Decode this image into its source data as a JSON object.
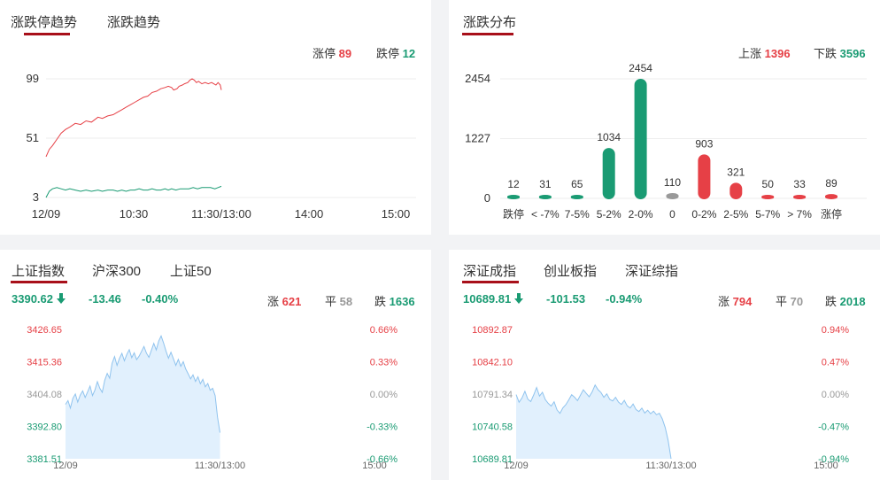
{
  "panel_limit": {
    "tabs": [
      "涨跌停趋势",
      "涨跌趋势"
    ],
    "stats": {
      "up_label": "涨停",
      "up_value": "89",
      "down_label": "跌停",
      "down_value": "12"
    }
  },
  "panel_dist": {
    "tabs": [
      "涨跌分布"
    ],
    "stats": {
      "up_label": "上涨",
      "up_value": "1396",
      "down_label": "下跌",
      "down_value": "3596"
    }
  },
  "panel_sh": {
    "tabs": [
      "上证指数",
      "沪深300",
      "上证50"
    ],
    "price": "3390.62",
    "change": "-13.46",
    "pct": "-0.40%",
    "stats": {
      "up_label": "涨",
      "up_value": "621",
      "flat_label": "平",
      "flat_value": "58",
      "down_label": "跌",
      "down_value": "1636"
    }
  },
  "panel_sz": {
    "tabs": [
      "深证成指",
      "创业板指",
      "深证综指"
    ],
    "price": "10689.81",
    "change": "-101.53",
    "pct": "-0.94%",
    "stats": {
      "up_label": "涨",
      "up_value": "794",
      "flat_label": "平",
      "flat_value": "70",
      "down_label": "跌",
      "down_value": "2018"
    }
  },
  "colors": {
    "red": "#e64046",
    "green": "#1a9b73",
    "gray": "#999999",
    "accent": "#a8101a",
    "area": "#e1f0fd",
    "area_line": "#8fc3ee"
  },
  "chart_data": [
    {
      "type": "line",
      "x_ticks": [
        "12/09",
        "10:30",
        "11:30/13:00",
        "14:00",
        "15:00"
      ],
      "y_ticks": [
        "99",
        "51",
        "3"
      ],
      "ylim": [
        3,
        99
      ],
      "series": [
        {
          "color": "red",
          "points": [
            [
              0,
              36
            ],
            [
              3,
              42
            ],
            [
              6,
              45
            ],
            [
              10,
              50
            ],
            [
              14,
              55
            ],
            [
              18,
              58
            ],
            [
              22,
              60
            ],
            [
              27,
              63
            ],
            [
              32,
              62
            ],
            [
              37,
              65
            ],
            [
              42,
              64
            ],
            [
              48,
              68
            ],
            [
              52,
              67
            ],
            [
              57,
              69
            ],
            [
              62,
              70
            ],
            [
              66,
              72
            ],
            [
              70,
              74
            ],
            [
              74,
              76
            ],
            [
              78,
              78
            ],
            [
              82,
              80
            ],
            [
              86,
              82
            ],
            [
              90,
              84
            ],
            [
              94,
              85
            ],
            [
              98,
              88
            ],
            [
              102,
              89
            ],
            [
              106,
              91
            ],
            [
              110,
              92
            ],
            [
              113,
              93
            ],
            [
              116,
              92
            ],
            [
              118,
              90
            ],
            [
              121,
              91
            ],
            [
              123,
              93
            ],
            [
              126,
              94
            ],
            [
              128,
              95
            ],
            [
              131,
              96
            ],
            [
              133,
              98
            ],
            [
              135,
              99
            ],
            [
              137,
              98
            ],
            [
              139,
              96
            ],
            [
              141,
              97
            ],
            [
              144,
              95
            ],
            [
              147,
              96
            ],
            [
              150,
              95
            ],
            [
              153,
              96
            ],
            [
              155,
              95
            ],
            [
              157,
              94
            ],
            [
              159,
              96
            ],
            [
              161,
              94
            ],
            [
              162,
              90
            ]
          ]
        },
        {
          "color": "green",
          "points": [
            [
              0,
              3
            ],
            [
              3,
              8
            ],
            [
              6,
              10
            ],
            [
              10,
              11
            ],
            [
              14,
              10
            ],
            [
              18,
              9
            ],
            [
              22,
              10
            ],
            [
              27,
              9
            ],
            [
              32,
              8
            ],
            [
              37,
              9
            ],
            [
              42,
              8
            ],
            [
              48,
              9
            ],
            [
              52,
              8
            ],
            [
              57,
              9
            ],
            [
              62,
              9
            ],
            [
              66,
              8
            ],
            [
              70,
              9
            ],
            [
              74,
              8
            ],
            [
              78,
              9
            ],
            [
              82,
              9
            ],
            [
              86,
              10
            ],
            [
              90,
              9
            ],
            [
              94,
              9
            ],
            [
              98,
              10
            ],
            [
              102,
              9
            ],
            [
              106,
              9
            ],
            [
              110,
              10
            ],
            [
              113,
              9
            ],
            [
              116,
              10
            ],
            [
              120,
              9
            ],
            [
              124,
              10
            ],
            [
              128,
              10
            ],
            [
              132,
              10
            ],
            [
              136,
              11
            ],
            [
              140,
              10
            ],
            [
              144,
              11
            ],
            [
              148,
              11
            ],
            [
              152,
              11
            ],
            [
              156,
              10
            ],
            [
              159,
              11
            ],
            [
              162,
              12
            ]
          ]
        }
      ]
    },
    {
      "type": "bar",
      "categories": [
        "跌停",
        "< -7%",
        "7-5%",
        "5-2%",
        "2-0%",
        "0",
        "0-2%",
        "2-5%",
        "5-7%",
        "> 7%",
        "涨停"
      ],
      "values": [
        12,
        31,
        65,
        1034,
        2454,
        110,
        903,
        321,
        50,
        33,
        89
      ],
      "colors": [
        "green",
        "green",
        "green",
        "green",
        "green",
        "gray",
        "red",
        "red",
        "red",
        "red",
        "red"
      ],
      "y_ticks": [
        "2454",
        "1227",
        "0"
      ],
      "ylim": [
        0,
        2454
      ]
    },
    {
      "type": "area",
      "y_ticks_left": [
        "3426.65",
        "3415.36",
        "3404.08",
        "3392.80",
        "3381.51"
      ],
      "y_ticks_right": [
        "0.66%",
        "0.33%",
        "0.00%",
        "-0.33%",
        "-0.66%"
      ],
      "x_ticks": [
        "12/09",
        "11:30/13:00",
        "15:00"
      ],
      "ylim": [
        3381.51,
        3426.65
      ],
      "values": [
        3400.5,
        3401.8,
        3399.2,
        3402.6,
        3404.1,
        3401.3,
        3403.7,
        3405.2,
        3402.9,
        3404.8,
        3406.9,
        3403.6,
        3405.5,
        3408.4,
        3406.1,
        3404.7,
        3408.9,
        3411.3,
        3409.6,
        3414.8,
        3417.2,
        3414.1,
        3416.5,
        3418.3,
        3415.7,
        3417.9,
        3419.6,
        3416.8,
        3418.5,
        3416.1,
        3417.3,
        3419.0,
        3420.7,
        3418.4,
        3416.9,
        3419.3,
        3421.8,
        3419.5,
        3422.6,
        3424.4,
        3421.9,
        3419.0,
        3416.6,
        3418.7,
        3416.4,
        3414.1,
        3416.2,
        3413.8,
        3415.4,
        3412.9,
        3411.2,
        3409.4,
        3410.8,
        3408.5,
        3410.1,
        3407.7,
        3409.2,
        3406.6,
        3407.8,
        3405.4,
        3406.1,
        3403.6,
        3396.0,
        3390.62
      ]
    },
    {
      "type": "area",
      "y_ticks_left": [
        "10892.87",
        "10842.10",
        "10791.34",
        "10740.58",
        "10689.81"
      ],
      "y_ticks_right": [
        "0.94%",
        "0.47%",
        "0.00%",
        "-0.47%",
        "-0.94%"
      ],
      "x_ticks": [
        "12/09",
        "11:30/13:00",
        "15:00"
      ],
      "ylim": [
        10689.81,
        10892.87
      ],
      "values": [
        10790.5,
        10778.6,
        10785.2,
        10795.8,
        10783.4,
        10779.7,
        10789.9,
        10801.6,
        10788.3,
        10794.1,
        10782.6,
        10776.8,
        10772.5,
        10779.3,
        10766.4,
        10761.2,
        10769.8,
        10774.6,
        10782.1,
        10790.3,
        10786.5,
        10781.0,
        10789.6,
        10798.2,
        10792.4,
        10787.1,
        10794.5,
        10805.6,
        10798.3,
        10793.9,
        10786.4,
        10791.7,
        10783.2,
        10780.6,
        10786.3,
        10778.8,
        10775.1,
        10781.4,
        10772.9,
        10769.5,
        10775.8,
        10767.2,
        10763.9,
        10769.3,
        10761.6,
        10766.0,
        10760.4,
        10764.7,
        10758.9,
        10761.2,
        10752.4,
        10738.7,
        10718.5,
        10689.81
      ]
    }
  ]
}
